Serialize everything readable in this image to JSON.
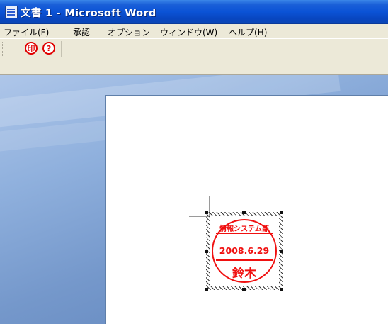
{
  "window": {
    "title": "文書 1 - Microsoft Word",
    "icon": "word-document-icon"
  },
  "menu": {
    "items": [
      {
        "label": "ファイル(F)"
      },
      {
        "label": "承認"
      },
      {
        "label": "オプション"
      },
      {
        "label": "ウィンドウ(W)"
      },
      {
        "label": "ヘルプ(H)"
      }
    ]
  },
  "toolbar": {
    "stamp_button_icon": "seal-icon",
    "stamp_button_glyph": "印",
    "help_button_icon": "help-icon",
    "help_button_glyph": "?"
  },
  "stamp": {
    "department": "情報システム部",
    "date": "2008.6.29",
    "name": "鈴木",
    "color": "#f01010"
  },
  "colors": {
    "title_bar": "#0b53d6",
    "menu_bg": "#ece9d8",
    "workspace": "#7598cb"
  }
}
